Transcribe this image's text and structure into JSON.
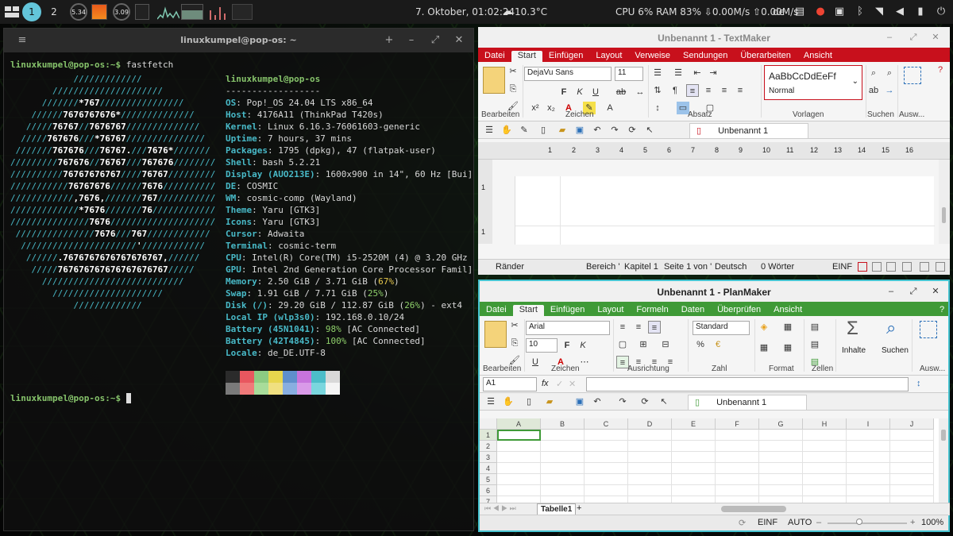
{
  "panel": {
    "workspaces": [
      "1",
      "2"
    ],
    "load1": "5.34",
    "load2": "3.09",
    "datetime": "7. Oktober, 01:02:24",
    "weather": "10.3°C",
    "sysmon": "CPU 6% RAM 83% ⇩0.00M/s ⇧0.00M/s",
    "lang": "de"
  },
  "terminal": {
    "title": "linuxkumpel@pop-os: ~",
    "prompt": "linuxkumpel@pop-os:~$ ",
    "command": "fastfetch",
    "user_host": "linuxkumpel@pop-os",
    "divider": "------------------",
    "logo_lines": [
      "            /////////////",
      "        /////////////////////",
      "      ///////*767////////////////",
      "    //////7676767676*//////////////",
      "   /////76767//7676767//////////////",
      "  /////767676///*76767///////////////",
      " ///////767676///76767.///7676*///////",
      "/////////767676//76767///767676////////",
      "//////////76767676767////76767/////////",
      "///////////76767676//////7676//////////",
      "////////////,7676,///////767///////////",
      "/////////////*7676///////76////////////",
      "///////////////7676////////////////////",
      " ///////////////7676///767////////////",
      "  //////////////////////'////////////",
      "   //////.7676767676767676767,//////",
      "    /////767676767676767676767/////",
      "      ///////////////////////////",
      "        /////////////////////",
      "            /////////////"
    ],
    "info": [
      {
        "k": "OS",
        "v": "Pop!_OS 24.04 LTS x86_64",
        "extra": "",
        "tail": ""
      },
      {
        "k": "Host",
        "v": "4176A11 (ThinkPad T420s)",
        "extra": "",
        "tail": ""
      },
      {
        "k": "Kernel",
        "v": "Linux 6.16.3-76061603-generic",
        "extra": "",
        "tail": ""
      },
      {
        "k": "Uptime",
        "v": "7 hours, 37 mins",
        "extra": "",
        "tail": ""
      },
      {
        "k": "Packages",
        "v": "1795 (dpkg), 47 (flatpak-user)",
        "extra": "",
        "tail": ""
      },
      {
        "k": "Shell",
        "v": "bash 5.2.21",
        "extra": "",
        "tail": ""
      },
      {
        "k": "Display (AUO213E)",
        "v": "1600x900 in 14\", 60 Hz [Bui]",
        "extra": "",
        "tail": ""
      },
      {
        "k": "DE",
        "v": "COSMIC",
        "extra": "",
        "tail": ""
      },
      {
        "k": "WM",
        "v": "cosmic-comp (Wayland)",
        "extra": "",
        "tail": ""
      },
      {
        "k": "Theme",
        "v": "Yaru [GTK3]",
        "extra": "",
        "tail": ""
      },
      {
        "k": "Icons",
        "v": "Yaru [GTK3]",
        "extra": "",
        "tail": ""
      },
      {
        "k": "Cursor",
        "v": "Adwaita",
        "extra": "",
        "tail": ""
      },
      {
        "k": "Terminal",
        "v": "cosmic-term",
        "extra": "",
        "tail": ""
      },
      {
        "k": "CPU",
        "v": "Intel(R) Core(TM) i5-2520M (4) @ 3.20 GHz",
        "extra": "",
        "tail": ""
      },
      {
        "k": "GPU",
        "v": "Intel 2nd Generation Core Processor Famil]",
        "extra": "",
        "tail": ""
      },
      {
        "k": "Memory",
        "v": "2.50 GiB / 3.71 GiB (",
        "extra": "67%",
        "tail": ")",
        "cls": "yel"
      },
      {
        "k": "Swap",
        "v": "1.91 GiB / 7.71 GiB (",
        "extra": "25%",
        "tail": ")",
        "cls": "grn"
      },
      {
        "k": "Disk (/)",
        "v": "29.20 GiB / 112.87 GiB (",
        "extra": "26%",
        "tail": ") - ext4",
        "cls": "grn"
      },
      {
        "k": "Local IP (wlp3s0)",
        "v": "192.168.0.10/24",
        "extra": "",
        "tail": ""
      },
      {
        "k": "Battery (45N1041)",
        "v": "",
        "extra": "98%",
        "tail": " [AC Connected]",
        "cls": "grn"
      },
      {
        "k": "Battery (42T4845)",
        "v": "",
        "extra": "100%",
        "tail": " [AC Connected]",
        "cls": "grn"
      },
      {
        "k": "Locale",
        "v": "de_DE.UTF-8",
        "extra": "",
        "tail": ""
      }
    ],
    "palette_top": [
      "#2b2b2b",
      "#e8575f",
      "#8ccb82",
      "#e8d64d",
      "#5e8fcc",
      "#c773dc",
      "#4cbdc9",
      "#d8d8d8"
    ],
    "palette_bottom": [
      "#7a7a7a",
      "#f07a7a",
      "#a8dc9a",
      "#f0e080",
      "#88aee0",
      "#d99ae8",
      "#7ad6de",
      "#f4f4f4"
    ]
  },
  "textmaker": {
    "title": "Unbenannt 1 - TextMaker",
    "accent": "#c8101c",
    "menus": [
      "Datei",
      "Start",
      "Einfügen",
      "Layout",
      "Verweise",
      "Sendungen",
      "Überarbeiten",
      "Ansicht"
    ],
    "help": "?",
    "font": "DejaVu Sans",
    "size": "11",
    "style_preview": "AaBbCcDdEeFf",
    "style_name": "Normal",
    "groups": [
      "Bearbeiten",
      "Zeichen",
      "Absatz",
      "Vorlagen",
      "Suchen",
      "Ausw..."
    ],
    "doc_tab": "Unbenannt 1",
    "ruler": [
      "1",
      "2",
      "3",
      "4",
      "5",
      "6",
      "7",
      "8",
      "9",
      "10",
      "11",
      "12",
      "13",
      "14",
      "15",
      "16"
    ],
    "vruler": [
      "1",
      "1"
    ],
    "status": {
      "s1": "Ränder",
      "s2": "Bereich '",
      "s3": "Kapitel 1",
      "s4": "Seite 1 von '",
      "s5": "Deutsch",
      "s6": "0 Wörter",
      "s7": "EINF"
    }
  },
  "planmaker": {
    "title": "Unbenannt 1 - PlanMaker",
    "accent": "#3f9a37",
    "menus": [
      "Datei",
      "Start",
      "Einfügen",
      "Layout",
      "Formeln",
      "Daten",
      "Überprüfen",
      "Ansicht"
    ],
    "help": "?",
    "font": "Arial",
    "size": "10",
    "numformat": "Standard",
    "groups": [
      "Bearbeiten",
      "Zeichen",
      "Ausrichtung",
      "Zahl",
      "Format",
      "Zellen",
      "Ausw..."
    ],
    "big_buttons": {
      "inhalte": "Inhalte",
      "suchen": "Suchen"
    },
    "cellref": "A1",
    "fx": "fx",
    "doc_tab": "Unbenannt 1",
    "columns": [
      "A",
      "B",
      "C",
      "D",
      "E",
      "F",
      "G",
      "H",
      "I",
      "J"
    ],
    "rows": [
      "1",
      "2",
      "3",
      "4",
      "5",
      "6",
      "7"
    ],
    "sheet_tab": "Tabelle1",
    "add_sheet": "+",
    "status": {
      "s1": "EINF",
      "s2": "AUTO",
      "zoom": "100%"
    }
  }
}
